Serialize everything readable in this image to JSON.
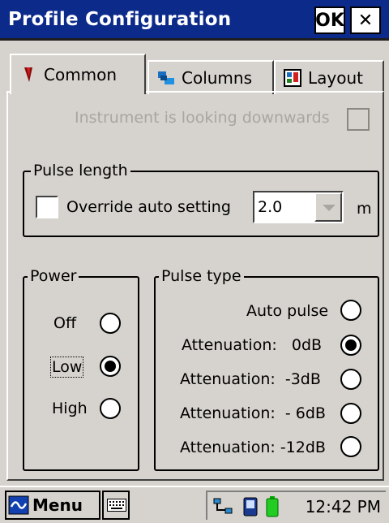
{
  "window": {
    "title": "Profile Configuration",
    "ok_label": "OK",
    "close_label": "✕"
  },
  "tabs": [
    {
      "label": "Common",
      "active": true,
      "icon": "red-pen-icon"
    },
    {
      "label": "Columns",
      "active": false,
      "icon": "columns-icon"
    },
    {
      "label": "Layout",
      "active": false,
      "icon": "layout-icon"
    }
  ],
  "instrument": {
    "label": "Instrument is looking downwards",
    "checked": false,
    "enabled": false
  },
  "pulse_length": {
    "group_label": "Pulse length",
    "override_label": "Override auto setting",
    "override_checked": false,
    "value": "2.0",
    "unit": "m"
  },
  "power": {
    "group_label": "Power",
    "options": [
      "Off",
      "Low",
      "High"
    ],
    "selected": "Low"
  },
  "pulse_type": {
    "group_label": "Pulse type",
    "options": [
      "Auto pulse",
      "Attenuation:   0dB",
      "Attenuation:  -3dB",
      "Attenuation:  - 6dB",
      "Attenuation: -12dB"
    ],
    "selected": "Attenuation:   0dB"
  },
  "taskbar": {
    "menu_label": "Menu",
    "time": "12:42 PM"
  }
}
